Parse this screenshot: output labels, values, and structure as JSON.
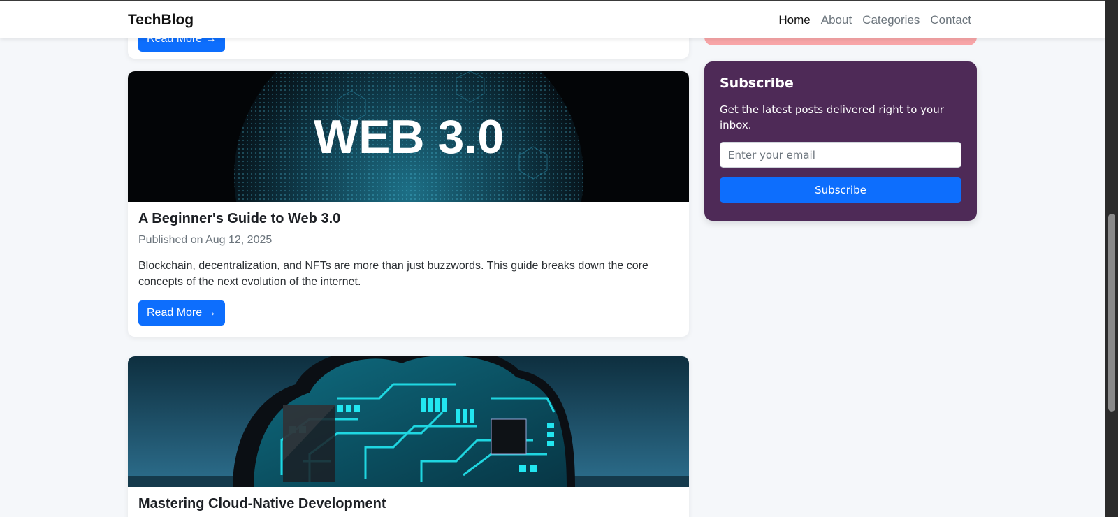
{
  "navbar": {
    "brand": "TechBlog",
    "links": [
      "Home",
      "About",
      "Categories",
      "Contact"
    ],
    "active": "Home"
  },
  "posts": [
    {
      "read_more": "Read More →"
    },
    {
      "image_text": "WEB 3.0",
      "title": "A Beginner's Guide to Web 3.0",
      "meta": "Published on Aug 12, 2025",
      "excerpt": "Blockchain, decentralization, and NFTs are more than just buzzwords. This guide breaks down the core concepts of the next evolution of the internet.",
      "read_more": "Read More →"
    },
    {
      "title": "Mastering Cloud-Native Development"
    }
  ],
  "subscribe": {
    "heading": "Subscribe",
    "description": "Get the latest posts delivered right to your inbox.",
    "email_placeholder": "Enter your email",
    "button": "Subscribe"
  },
  "colors": {
    "primary": "#0d6efd",
    "subscribe_bg": "#4e2a57",
    "widget_pink": "#f8a5a8",
    "page_bg": "#f5f7fa"
  }
}
